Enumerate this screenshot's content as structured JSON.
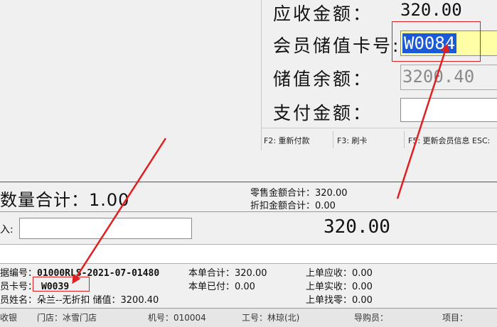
{
  "payment_dialog": {
    "receivable_label": "应收金额：",
    "receivable_value": "320.00",
    "member_card_label": "会员储值卡号:",
    "member_card_value": "W0084",
    "balance_label": "储值余额：",
    "balance_value": "3200.40",
    "pay_amount_label": "支付金额：",
    "pay_amount_value": "",
    "fkeys": [
      "F2: 重新付款",
      "F3: 刷卡",
      "F5: 更新会员信息 ESC:"
    ]
  },
  "summary": {
    "quantity_total": "数量合计：1.00",
    "retail_total": "零售金额合计：320.00",
    "discount_total": "折扣金额合计：0.00",
    "input_label": "入:",
    "input_value": "",
    "big_total": "320.00"
  },
  "order_info": {
    "doc_no_label": "据编号：",
    "doc_no_value": "01000RLS-2021-07-01480",
    "card_label": "员卡号：",
    "card_value": "W0039",
    "name_line": "员姓名：朵兰--无折扣  储值：3200.40",
    "current_total": "本单合计：320.00",
    "current_paid": "本单已付：0.00",
    "prev_receivable": "上单应收：0.00",
    "prev_received": "上单实收：0.00",
    "prev_change": "上单找零：0.00"
  },
  "grid_header": {
    "col1": "收银",
    "col2": "门店：冰雪门店",
    "col3": "机号：010004",
    "col4": "工号：林琼(北)",
    "col5": "导购员：",
    "col6": "项目："
  },
  "colors": {
    "annotation_red": "#e02020",
    "selection_blue": "#1a5ad8",
    "member_field_yellow": "#ffffa6"
  }
}
